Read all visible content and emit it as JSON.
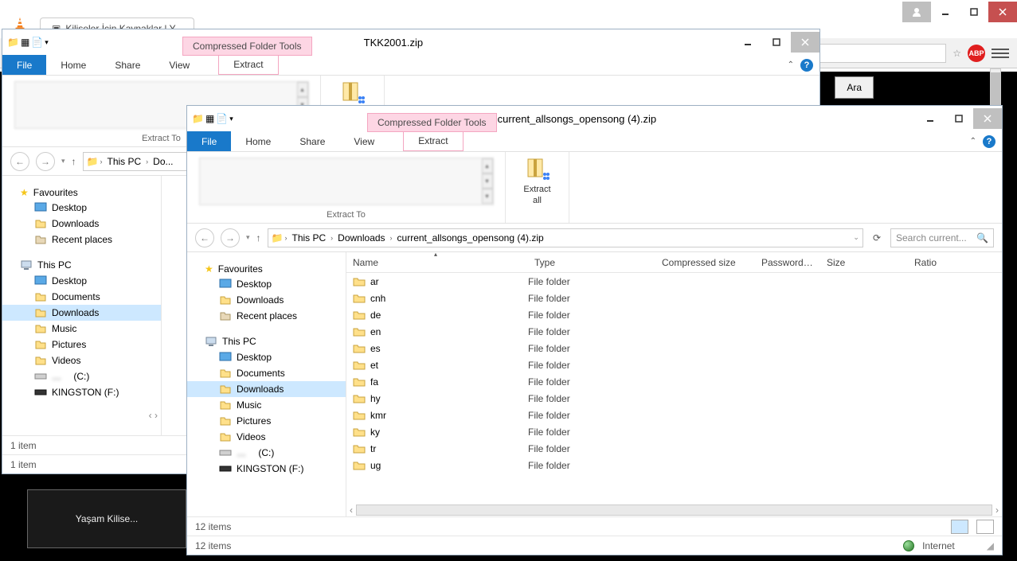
{
  "browser": {
    "tab_title": "Kiliseler İçin Kaynaklar | Y...",
    "star_aria": "Bookmark",
    "abp": "ABP",
    "search_btn": "Ara"
  },
  "thumb_caption": "Yaşam Kilise...",
  "win1": {
    "title": "TKK2001.zip",
    "ctx_tab": "Compressed Folder Tools",
    "tabs": {
      "file": "File",
      "home": "Home",
      "share": "Share",
      "view": "View",
      "extract": "Extract"
    },
    "group_label": "Extract To",
    "extract_all": "Extract\nall",
    "breadcrumb": [
      "This PC",
      "Do..."
    ],
    "fav_header": "Favourites",
    "fav": [
      "Desktop",
      "Downloads",
      "Recent places"
    ],
    "pc_header": "This PC",
    "pc": [
      "Desktop",
      "Documents",
      "Downloads",
      "Music",
      "Pictures",
      "Videos",
      "(C:)",
      "KINGSTON (F:)"
    ],
    "blurred_drive": "…",
    "status_a": "1 item",
    "status_b": "1 item"
  },
  "win2": {
    "title": "current_allsongs_opensong (4).zip",
    "ctx_tab": "Compressed Folder Tools",
    "tabs": {
      "file": "File",
      "home": "Home",
      "share": "Share",
      "view": "View",
      "extract": "Extract"
    },
    "group_label": "Extract To",
    "extract_all": "Extract\nall",
    "breadcrumb": [
      "This PC",
      "Downloads",
      "current_allsongs_opensong (4).zip"
    ],
    "search_placeholder": "Search current...",
    "fav_header": "Favourites",
    "fav": [
      "Desktop",
      "Downloads",
      "Recent places"
    ],
    "pc_header": "This PC",
    "pc": [
      "Desktop",
      "Documents",
      "Downloads",
      "Music",
      "Pictures",
      "Videos",
      "(C:)",
      "KINGSTON (F:)"
    ],
    "columns": {
      "name": "Name",
      "type": "Type",
      "csize": "Compressed size",
      "pwd": "Password ...",
      "size": "Size",
      "ratio": "Ratio"
    },
    "rows": [
      {
        "name": "ar",
        "type": "File folder"
      },
      {
        "name": "cnh",
        "type": "File folder"
      },
      {
        "name": "de",
        "type": "File folder"
      },
      {
        "name": "en",
        "type": "File folder"
      },
      {
        "name": "es",
        "type": "File folder"
      },
      {
        "name": "et",
        "type": "File folder"
      },
      {
        "name": "fa",
        "type": "File folder"
      },
      {
        "name": "hy",
        "type": "File folder"
      },
      {
        "name": "kmr",
        "type": "File folder"
      },
      {
        "name": "ky",
        "type": "File folder"
      },
      {
        "name": "tr",
        "type": "File folder"
      },
      {
        "name": "ug",
        "type": "File folder"
      }
    ],
    "status_a": "12 items",
    "status_b": "12 items",
    "internet": "Internet"
  }
}
